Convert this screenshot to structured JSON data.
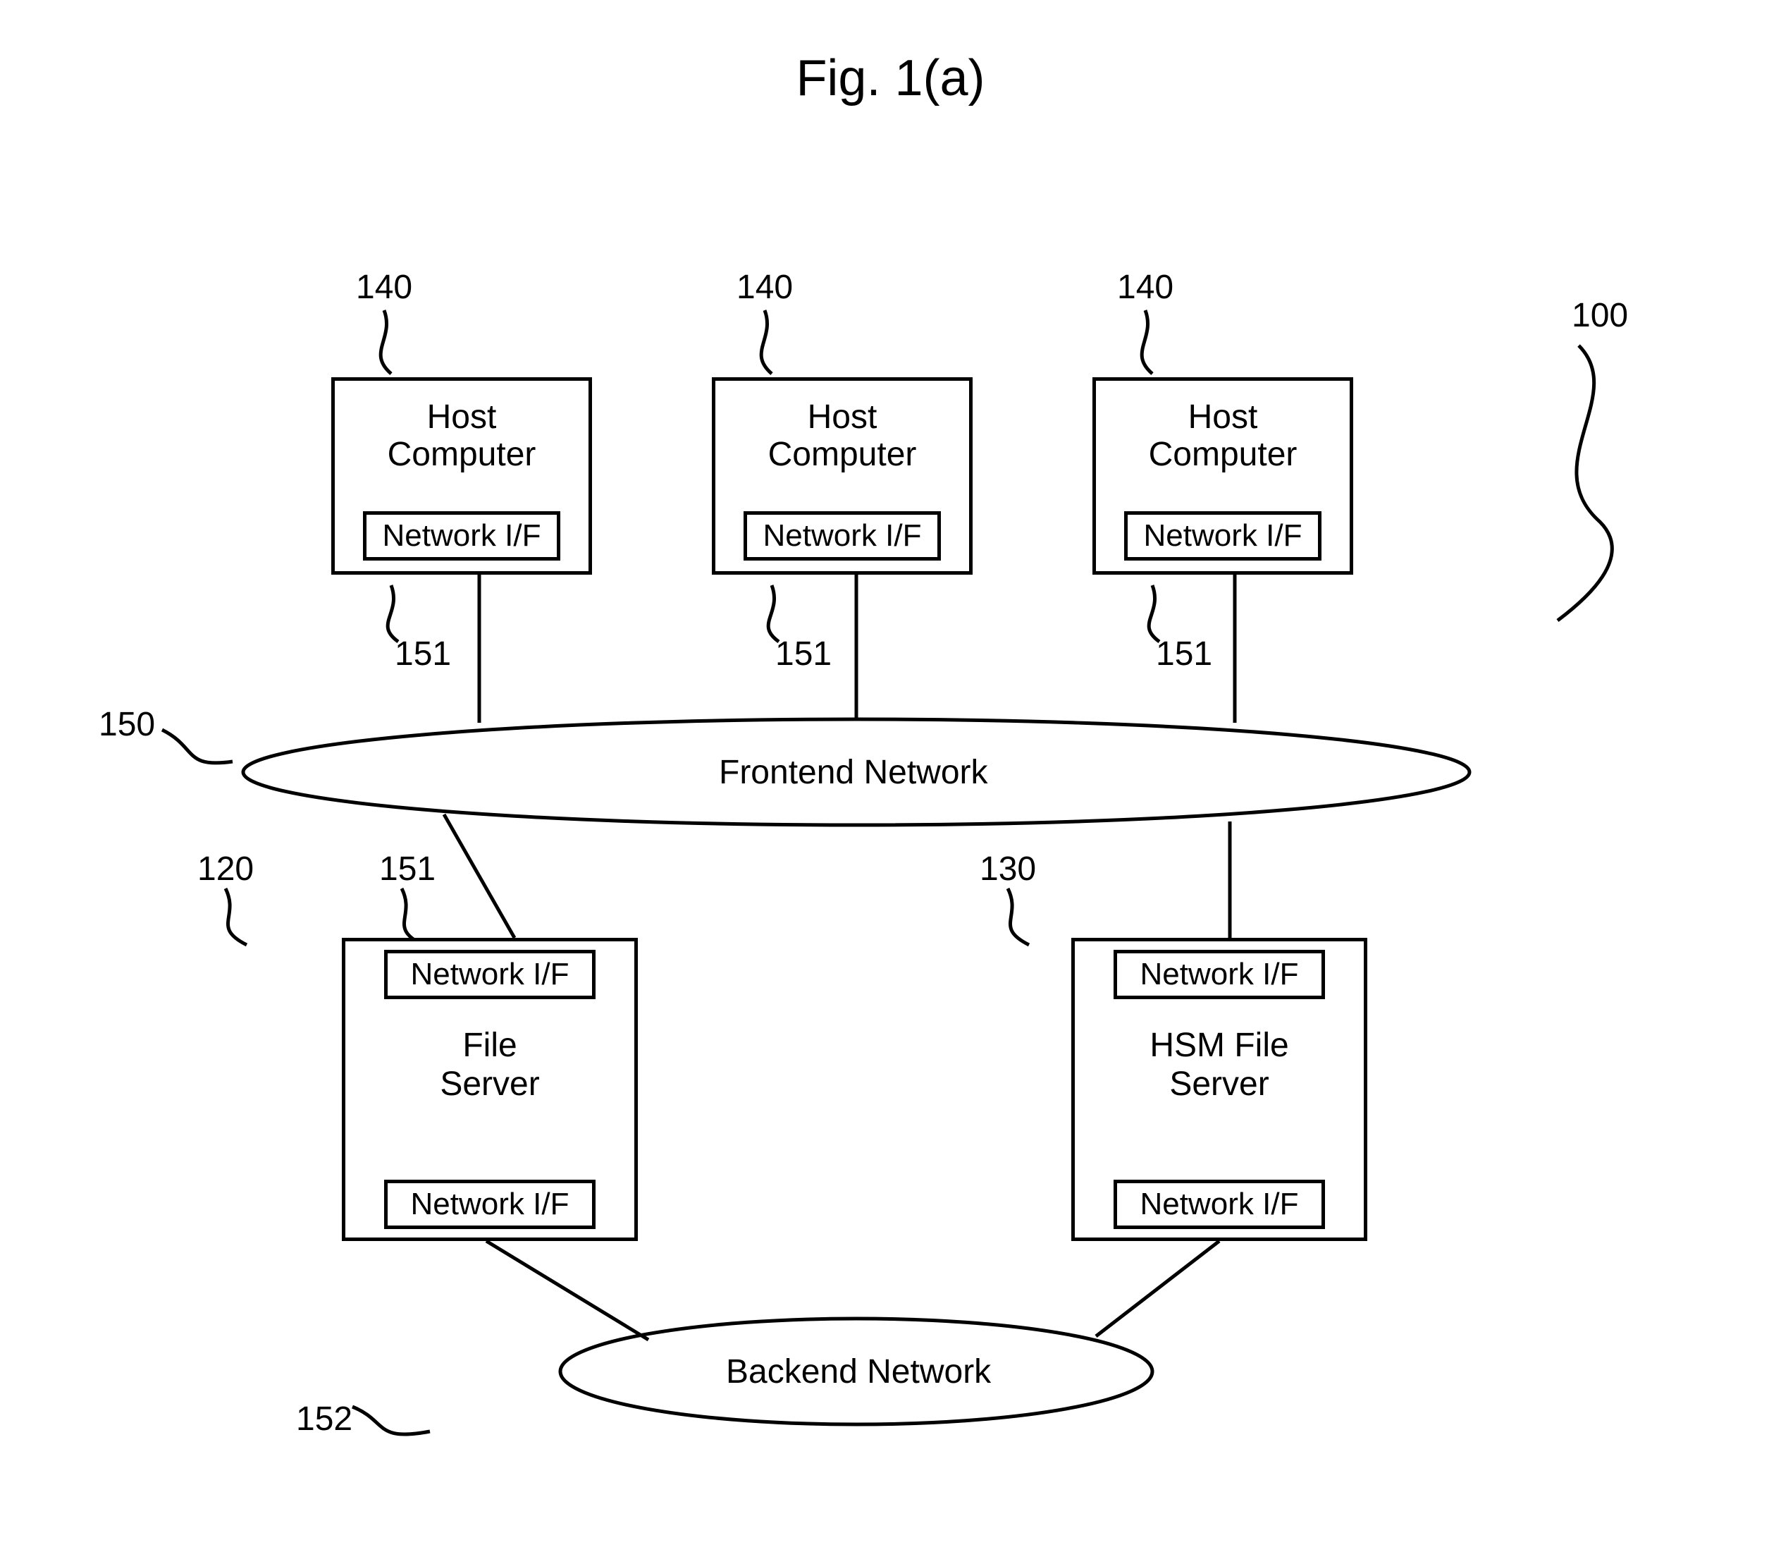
{
  "figure": {
    "title": "Fig. 1(a)"
  },
  "hosts": {
    "label_line1": "Host",
    "label_line2": "Computer",
    "nif": "Network I/F"
  },
  "frontend_network": {
    "label": "Frontend Network"
  },
  "backend_network": {
    "label": "Backend Network"
  },
  "file_server": {
    "label_line1": "File",
    "label_line2": "Server",
    "nif_top": "Network I/F",
    "nif_bottom": "Network I/F"
  },
  "hsm_server": {
    "label_line1": "HSM File",
    "label_line2": "Server",
    "nif_top": "Network I/F",
    "nif_bottom": "Network I/F"
  },
  "refs": {
    "r100": "100",
    "r120": "120",
    "r130": "130",
    "r140a": "140",
    "r140b": "140",
    "r140c": "140",
    "r150": "150",
    "r151a": "151",
    "r151b": "151",
    "r151c": "151",
    "r151d": "151",
    "r152": "152"
  }
}
